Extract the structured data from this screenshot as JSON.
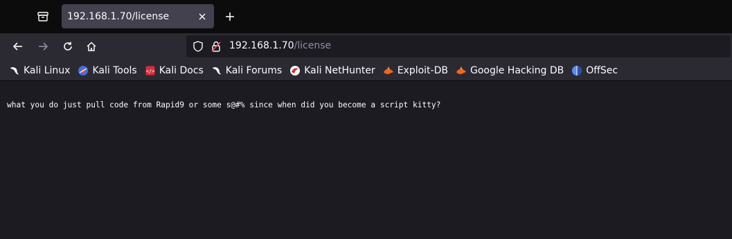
{
  "tab": {
    "title": "192.168.1.70/license"
  },
  "urlbar": {
    "host": "192.168.1.70",
    "path": "/license"
  },
  "bookmarks": [
    {
      "label": "Kali Linux",
      "icon": "kali-dragon-icon"
    },
    {
      "label": "Kali Tools",
      "icon": "kali-tools-icon"
    },
    {
      "label": "Kali Docs",
      "icon": "kali-docs-icon"
    },
    {
      "label": "Kali Forums",
      "icon": "kali-dragon-icon"
    },
    {
      "label": "Kali NetHunter",
      "icon": "nethunter-icon"
    },
    {
      "label": "Exploit-DB",
      "icon": "exploit-db-icon"
    },
    {
      "label": "Google Hacking DB",
      "icon": "exploit-db-icon"
    },
    {
      "label": "OffSec",
      "icon": "offsec-icon"
    }
  ],
  "page": {
    "text": "what you do just pull code from Rapid9 or some s@#% since when did you become a script kitty?"
  },
  "colors": {
    "tabstrip": "#0c0c0d",
    "toolbar": "#2b2a33",
    "active_tab": "#42414d",
    "content_bg": "#1c1b22",
    "text": "#fbfbfe",
    "dim_text": "#8f8f9d",
    "lock_warning": "#ff4f5e"
  }
}
